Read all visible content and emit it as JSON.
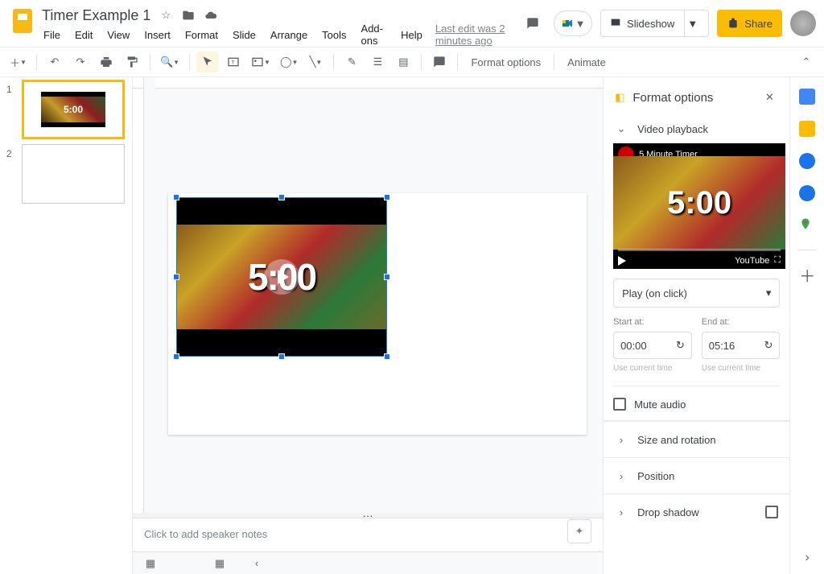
{
  "header": {
    "title": "Timer Example 1",
    "last_edit": "Last edit was 2 minutes ago",
    "menus": [
      "File",
      "Edit",
      "View",
      "Insert",
      "Format",
      "Slide",
      "Arrange",
      "Tools",
      "Add-ons",
      "Help"
    ],
    "slideshow": "Slideshow",
    "share": "Share"
  },
  "toolbar": {
    "format_options": "Format options",
    "animate": "Animate"
  },
  "thumbnails": {
    "slide1_num": "1",
    "slide2_num": "2",
    "slide1_timer": "5:00"
  },
  "canvas": {
    "timer_text": "5:00"
  },
  "notes": {
    "placeholder": "Click to add speaker notes"
  },
  "panel": {
    "title": "Format options",
    "video_playback": "Video playback",
    "preview_title": "5 Minute Timer",
    "preview_timer": "5:00",
    "youtube": "YouTube",
    "play_mode": "Play (on click)",
    "start_label": "Start at:",
    "end_label": "End at:",
    "start_value": "00:00",
    "end_value": "05:16",
    "use_current": "Use current time",
    "mute": "Mute audio",
    "size_rotation": "Size and rotation",
    "position": "Position",
    "drop_shadow": "Drop shadow"
  }
}
